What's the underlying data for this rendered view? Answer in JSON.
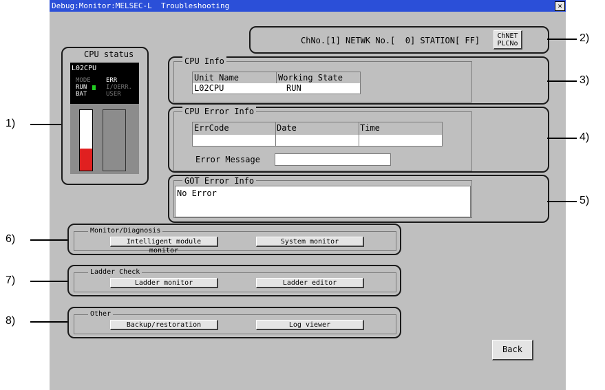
{
  "window": {
    "title": "Debug:Monitor:MELSEC-L  Troubleshooting",
    "close_glyph": "×"
  },
  "channel_bar": {
    "text": "ChNo.[1] NETWK No.[  0] STATION[ FF]",
    "button_line1": "ChNET",
    "button_line2": "PLCNo"
  },
  "cpu_status": {
    "title": "CPU status",
    "model": "L02CPU",
    "mode_label": "MODE",
    "run_label": "RUN",
    "bat_label": "BAT",
    "err_label": "ERR",
    "io_err_label": "I/OERR.",
    "user_label": "USER",
    "run_led_color": "#22cc22",
    "bar_fill_color": "#e02020"
  },
  "cpu_info": {
    "title": "CPU Info",
    "columns": [
      "Unit Name",
      "Working State"
    ],
    "values": [
      "L02CPU",
      "RUN"
    ]
  },
  "cpu_error_info": {
    "title": "CPU Error Info",
    "columns": [
      "ErrCode",
      "Date",
      "Time"
    ],
    "values": [
      "",
      "",
      ""
    ],
    "message_label": "Error Message",
    "message_value": ""
  },
  "got_error_info": {
    "title": "GOT Error Info",
    "text": "No Error"
  },
  "monitor_diagnosis": {
    "title": "Monitor/Diagnosis",
    "buttons": [
      "Intelligent module monitor",
      "System monitor"
    ]
  },
  "ladder_check": {
    "title": "Ladder Check",
    "buttons": [
      "Ladder monitor",
      "Ladder editor"
    ]
  },
  "other": {
    "title": "Other",
    "buttons": [
      "Backup/restoration",
      "Log viewer"
    ]
  },
  "back_button": "Back",
  "callouts": [
    "1)",
    "2)",
    "3)",
    "4)",
    "5)",
    "6)",
    "7)",
    "8)"
  ]
}
